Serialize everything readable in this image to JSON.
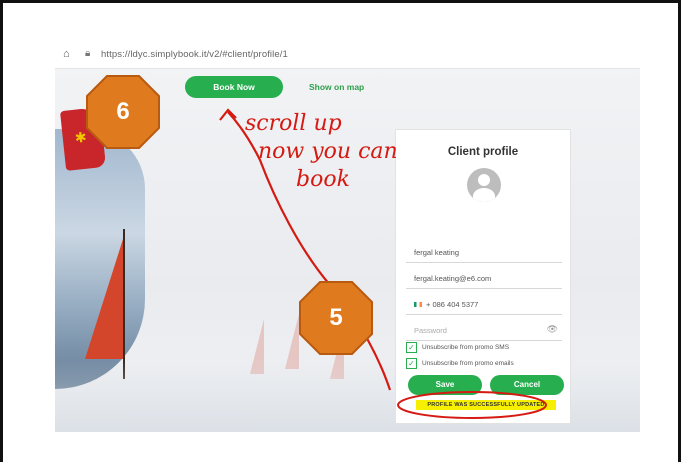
{
  "browser": {
    "url": "https://ldyc.simplybook.it/v2/#client/profile/1",
    "home_icon": "home-icon",
    "lock_icon": "lock-icon"
  },
  "toolbar": {
    "book_now_label": "Book Now",
    "show_on_map_label": "Show on map"
  },
  "profile": {
    "title": "Client profile",
    "name": "fergal keating",
    "email": "fergal.keating@e6.com",
    "phone": "+ 086 404 5377",
    "password_placeholder": "Password",
    "unsubscribe_sms": "Unsubscribe from promo SMS",
    "unsubscribe_emails": "Unsubscribe from promo emails",
    "save_label": "Save",
    "cancel_label": "Cancel",
    "success_message": "PROFILE WAS SUCCESSFULLY UPDATED"
  },
  "annotations": {
    "handwritten_line1": "scroll up",
    "handwritten_line2": "now you can",
    "handwritten_line3": "book",
    "badge_6": "6",
    "badge_5": "5",
    "colors": {
      "ink": "#d41a12",
      "badge_fill": "#e07a1e",
      "badge_border": "#b85a10",
      "accent_green": "#27ae4f",
      "highlight_yellow": "#f6f000"
    }
  }
}
